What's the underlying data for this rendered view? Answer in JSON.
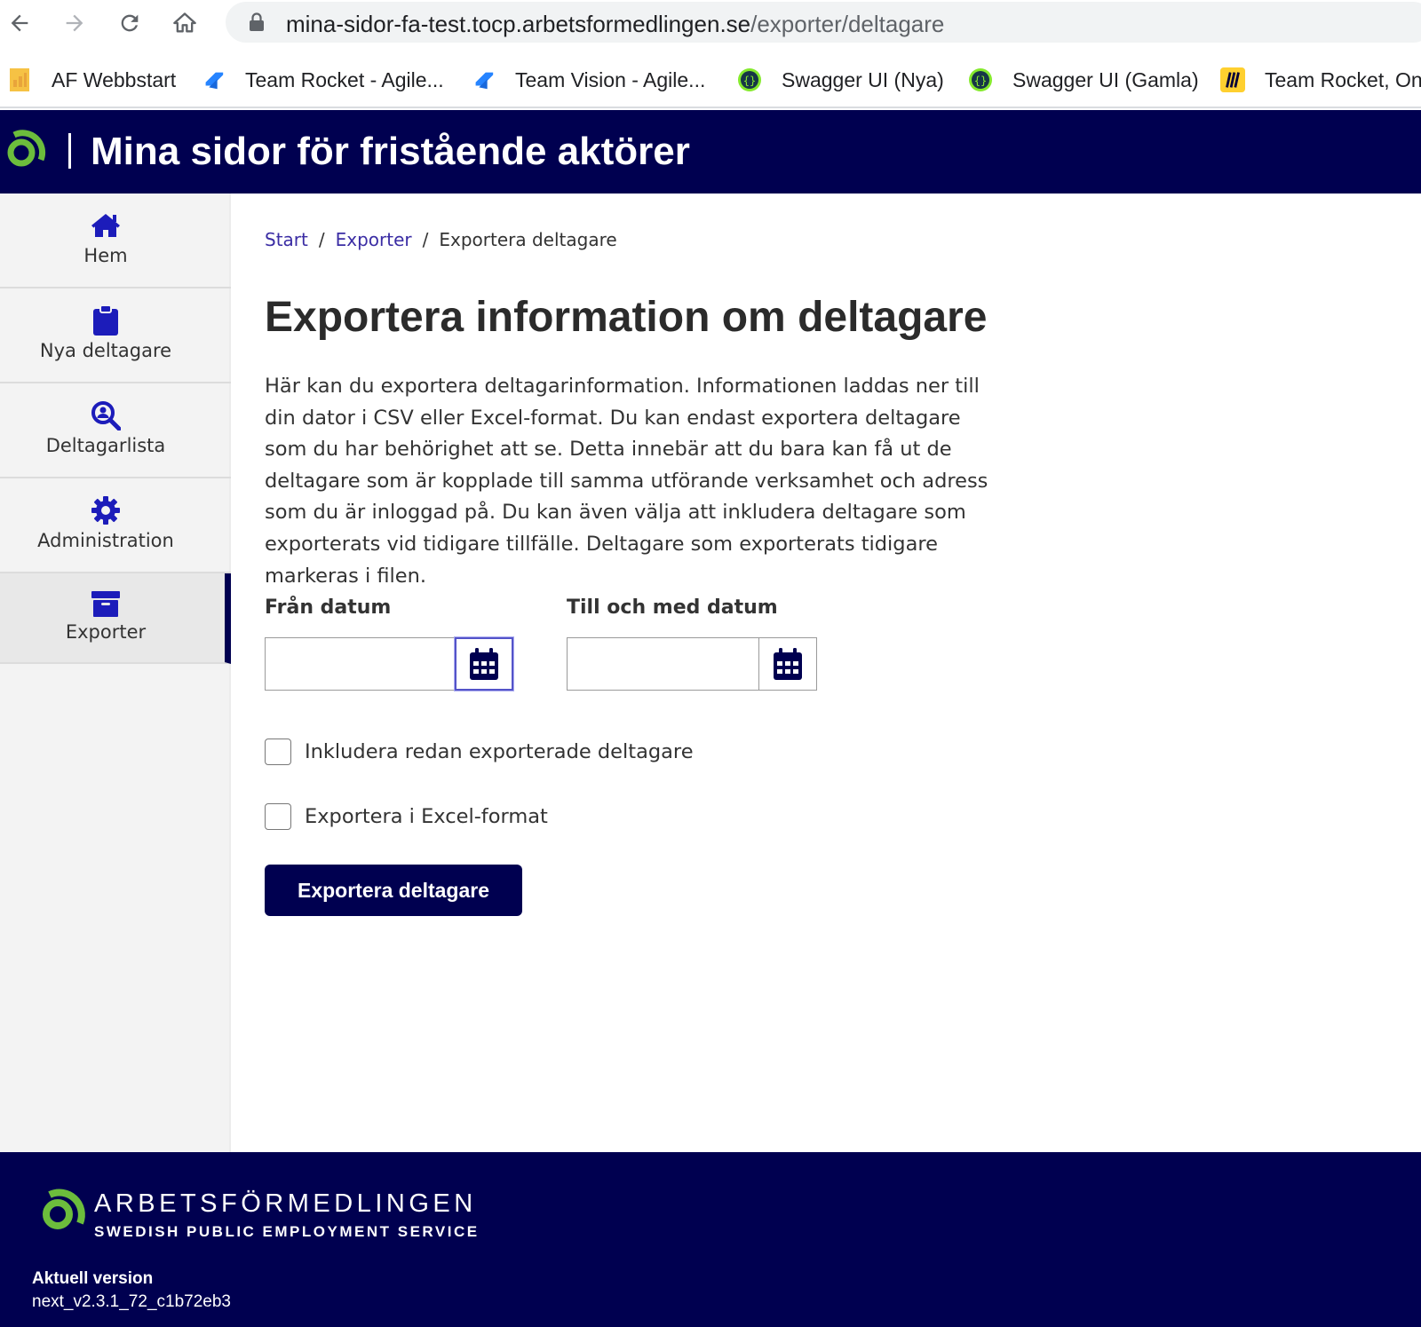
{
  "browser": {
    "url_host": "mina-sidor-fa-test.tocp.arbetsformedlingen.se",
    "url_path": "/exporter/deltagare",
    "bookmarks": [
      {
        "label": "AF Webbstart",
        "icon": "document-bookmark-icon"
      },
      {
        "label": "Team Rocket - Agile...",
        "icon": "jira-icon"
      },
      {
        "label": "Team Vision - Agile...",
        "icon": "jira-icon"
      },
      {
        "label": "Swagger UI (Nya)",
        "icon": "swagger-icon"
      },
      {
        "label": "Swagger UI (Gamla)",
        "icon": "swagger-icon"
      },
      {
        "label": "Team Rocket, Onl",
        "icon": "miro-icon"
      }
    ]
  },
  "header": {
    "title": "Mina sidor för fristående aktörer",
    "bg_color": "#000050",
    "logo_color": "#6cbd3c"
  },
  "sidebar": {
    "items": [
      {
        "label": "Hem",
        "icon": "home-icon",
        "active": false
      },
      {
        "label": "Nya deltagare",
        "icon": "clipboard-icon",
        "active": false
      },
      {
        "label": "Deltagarlista",
        "icon": "search-person-icon",
        "active": false
      },
      {
        "label": "Administration",
        "icon": "gear-icon",
        "active": false
      },
      {
        "label": "Exporter",
        "icon": "archive-icon",
        "active": true
      }
    ],
    "icon_color": "#1c1cba"
  },
  "breadcrumb": {
    "items": [
      "Start",
      "Exporter",
      "Exportera deltagare"
    ],
    "separator": "/"
  },
  "main": {
    "title": "Exportera information om deltagare",
    "intro": "Här kan du exportera deltagarinformation. Informationen laddas ner till din dator i CSV eller Excel-format. Du kan endast exportera deltagare som du har behörighet att se. Detta innebär att du bara kan få ut de deltagare som är kopplade till samma utförande verksamhet och adress som du är inloggad på. Du kan även välja att inkludera deltagare som exporterats vid tidigare tillfälle. Deltagare som exporterats tidigare markeras i filen.",
    "from_date": {
      "label": "Från datum",
      "value": ""
    },
    "to_date": {
      "label": "Till och med datum",
      "value": ""
    },
    "checkboxes": [
      {
        "label": "Inkludera redan exporterade deltagare",
        "checked": false
      },
      {
        "label": "Exportera i Excel-format",
        "checked": false
      }
    ],
    "submit_label": "Exportera deltagare"
  },
  "footer": {
    "brand_name": "ARBETSFÖRMEDLINGEN",
    "brand_sub": "SWEDISH PUBLIC EMPLOYMENT SERVICE",
    "version_label": "Aktuell version",
    "version_value": "next_v2.3.1_72_c1b72eb3"
  }
}
